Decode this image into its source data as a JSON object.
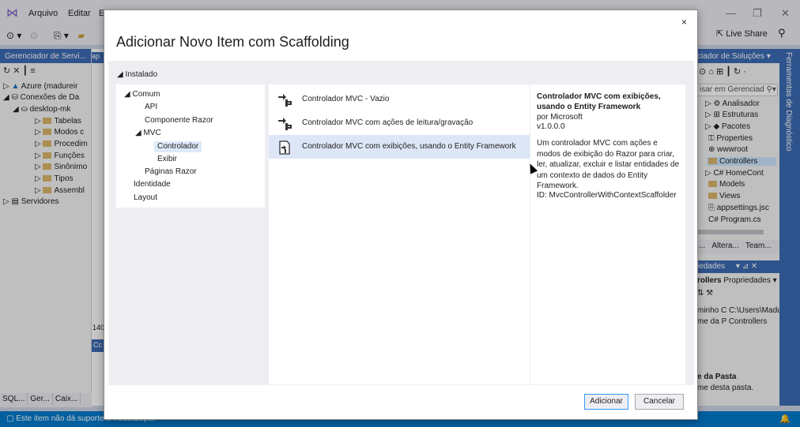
{
  "ide": {
    "menu": [
      "Arquivo",
      "Editar",
      "E"
    ],
    "live_share": "Live Share",
    "left_panel": {
      "title": "Gerenciador de Servi...",
      "tree": [
        {
          "label": "Azure (madureir",
          "indent": 0
        },
        {
          "label": "Conexões de Da",
          "indent": 0
        },
        {
          "label": "desktop-mk",
          "indent": 1
        },
        {
          "label": "Tabelas",
          "indent": 2
        },
        {
          "label": "Modos c",
          "indent": 2
        },
        {
          "label": "Procedim",
          "indent": 2
        },
        {
          "label": "Funções",
          "indent": 2
        },
        {
          "label": "Sinônimo",
          "indent": 2
        },
        {
          "label": "Tipos",
          "indent": 2
        },
        {
          "label": "Assembl",
          "indent": 2
        },
        {
          "label": "Servidores",
          "indent": 0
        }
      ],
      "tabs": [
        "SQL...",
        "Ger...",
        "Caix..."
      ]
    },
    "middle": {
      "tab_fragment": "ap",
      "line_num": "140",
      "output_fragment": "Cc"
    },
    "right_panel": {
      "title": "ciador de Soluções",
      "search_placeholder": "isar em Gerenciad",
      "tree": [
        {
          "label": "Analisador",
          "selected": false
        },
        {
          "label": "Estruturas",
          "selected": false
        },
        {
          "label": "Pacotes",
          "selected": false
        },
        {
          "label": "Properties",
          "selected": false
        },
        {
          "label": "wwwroot",
          "selected": false
        },
        {
          "label": "Controllers",
          "selected": true
        },
        {
          "label": "HomeCont",
          "selected": false
        },
        {
          "label": "Models",
          "selected": false
        },
        {
          "label": "Views",
          "selected": false
        },
        {
          "label": "appsettings.jsc",
          "selected": false
        },
        {
          "label": "Program.cs",
          "selected": false
        }
      ],
      "tabs": [
        "...",
        "Altera...",
        "Team..."
      ],
      "properties_title": "iedades",
      "properties_object": "rollers",
      "properties_label": "Propriedades",
      "prop_rows": [
        "minho C C:\\Users\\Madur",
        "me da P Controllers"
      ],
      "folder_name_title": "e da Pasta",
      "folder_name_desc": "me desta pasta."
    },
    "diagnostic_strip": "Ferramentas de Diagnóstico",
    "status_text": "Este item não dá suporte à visualização"
  },
  "dialog": {
    "title": "Adicionar Novo Item com Scaffolding",
    "close_label": "×",
    "installed_label": "Instalado",
    "categories": [
      {
        "label": "Comum",
        "level": 0,
        "expand": "◢"
      },
      {
        "label": "API",
        "level": 1
      },
      {
        "label": "Componente Razor",
        "level": 1
      },
      {
        "label": "MVC",
        "level": 1,
        "expand": "◢"
      },
      {
        "label": "Controlador",
        "level": 2,
        "selected": true
      },
      {
        "label": "Exibir",
        "level": 2
      },
      {
        "label": "Páginas Razor",
        "level": 1
      },
      {
        "label": "Identidade",
        "level": 0
      },
      {
        "label": "Layout",
        "level": 0
      }
    ],
    "templates": [
      {
        "name": "Controlador MVC - Vazio",
        "selected": false
      },
      {
        "name": "Controlador MVC com ações de leitura/gravação",
        "selected": false
      },
      {
        "name": "Controlador MVC com exibições, usando o Entity Framework",
        "selected": true
      }
    ],
    "details": {
      "title": "Controlador MVC com exibições, usando o Entity Framework",
      "author": "por Microsoft",
      "version": "v1.0.0.0",
      "description": "Um controlador MVC com ações e modos de exibição do Razor para criar, ler, atualizar, excluir e listar entidades de um contexto de dados do Entity Framework.",
      "id": "ID: MvcControllerWithContextScaffolder"
    },
    "buttons": {
      "add": "Adicionar",
      "cancel": "Cancelar"
    }
  }
}
